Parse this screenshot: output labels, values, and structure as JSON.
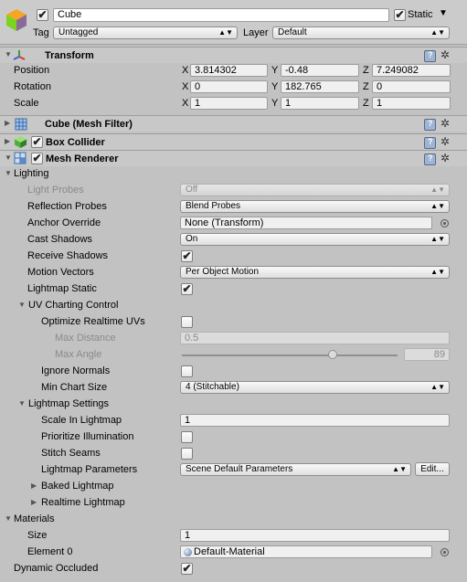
{
  "object": {
    "name": "Cube",
    "static_label": "Static",
    "tag_label": "Tag",
    "tag_value": "Untagged",
    "layer_label": "Layer",
    "layer_value": "Default"
  },
  "transform": {
    "title": "Transform",
    "position_label": "Position",
    "rotation_label": "Rotation",
    "scale_label": "Scale",
    "axis_x": "X",
    "axis_y": "Y",
    "axis_z": "Z",
    "position": {
      "x": "3.814302",
      "y": "-0.48",
      "z": "7.249082"
    },
    "rotation": {
      "x": "0",
      "y": "182.765",
      "z": "0"
    },
    "scale": {
      "x": "1",
      "y": "1",
      "z": "1"
    }
  },
  "components": {
    "mesh_filter": "Cube (Mesh Filter)",
    "box_collider": "Box Collider",
    "mesh_renderer": "Mesh Renderer"
  },
  "lighting": {
    "section": "Lighting",
    "light_probes_label": "Light Probes",
    "light_probes_value": "Off",
    "reflection_probes_label": "Reflection Probes",
    "reflection_probes_value": "Blend Probes",
    "anchor_override_label": "Anchor Override",
    "anchor_override_value": "None (Transform)",
    "cast_shadows_label": "Cast Shadows",
    "cast_shadows_value": "On",
    "receive_shadows_label": "Receive Shadows",
    "motion_vectors_label": "Motion Vectors",
    "motion_vectors_value": "Per Object Motion",
    "lightmap_static_label": "Lightmap Static"
  },
  "uv_charting": {
    "section": "UV Charting Control",
    "optimize_label": "Optimize Realtime UVs",
    "max_distance_label": "Max Distance",
    "max_distance_value": "0.5",
    "max_angle_label": "Max Angle",
    "max_angle_value": "89",
    "max_angle_fraction": 0.7,
    "ignore_normals_label": "Ignore Normals",
    "min_chart_label": "Min Chart Size",
    "min_chart_value": "4 (Stitchable)"
  },
  "lightmap_settings": {
    "section": "Lightmap Settings",
    "scale_label": "Scale In Lightmap",
    "scale_value": "1",
    "prioritize_label": "Prioritize Illumination",
    "stitch_label": "Stitch Seams",
    "params_label": "Lightmap Parameters",
    "params_value": "Scene Default Parameters",
    "edit_label": "Edit...",
    "baked_label": "Baked Lightmap",
    "realtime_label": "Realtime Lightmap"
  },
  "materials": {
    "section": "Materials",
    "size_label": "Size",
    "size_value": "1",
    "element_label": "Element 0",
    "element_value": "Default-Material",
    "dynamic_label": "Dynamic Occluded"
  },
  "icons": {
    "check": "✔",
    "dropdown_arrow": "▾",
    "tri_down": "▼",
    "tri_right": "▶",
    "gear": "✲"
  },
  "colors": {
    "header_bg": "#c8c8c8",
    "panel_bg": "#c2c2c2",
    "help_icon": "#9eb4d2"
  }
}
